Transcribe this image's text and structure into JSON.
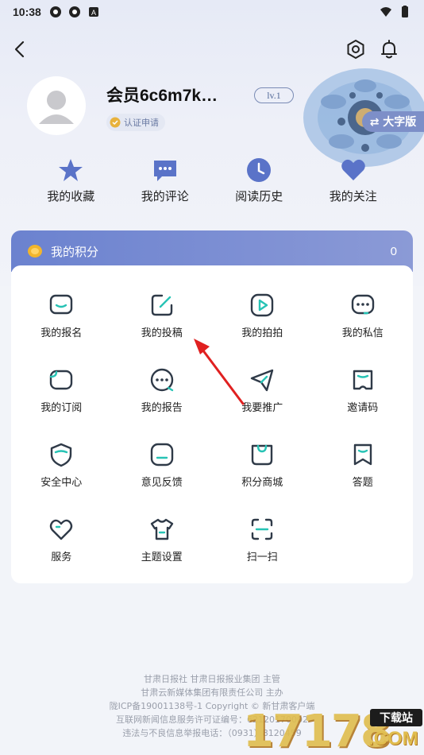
{
  "status_bar": {
    "time": "10:38"
  },
  "profile": {
    "username": "会员6c6m7k…",
    "level": "lv.1",
    "verify_label": "认证申请",
    "font_size_button": "⇄ 大字版"
  },
  "quick_links": [
    {
      "label": "我的收藏",
      "icon": "star-icon"
    },
    {
      "label": "我的评论",
      "icon": "comment-icon"
    },
    {
      "label": "阅读历史",
      "icon": "clock-icon"
    },
    {
      "label": "我的关注",
      "icon": "heart-icon"
    }
  ],
  "points": {
    "label": "我的积分",
    "value": "0"
  },
  "grid": [
    {
      "label": "我的报名",
      "icon": "signup-icon"
    },
    {
      "label": "我的投稿",
      "icon": "edit-icon"
    },
    {
      "label": "我的拍拍",
      "icon": "video-icon"
    },
    {
      "label": "我的私信",
      "icon": "message-icon"
    },
    {
      "label": "我的订阅",
      "icon": "subscribe-icon"
    },
    {
      "label": "我的报告",
      "icon": "report-icon"
    },
    {
      "label": "我要推广",
      "icon": "send-icon"
    },
    {
      "label": "邀请码",
      "icon": "invite-icon"
    },
    {
      "label": "安全中心",
      "icon": "shield-icon"
    },
    {
      "label": "意见反馈",
      "icon": "feedback-icon"
    },
    {
      "label": "积分商城",
      "icon": "shop-icon"
    },
    {
      "label": "答题",
      "icon": "quiz-icon"
    },
    {
      "label": "服务",
      "icon": "service-heart-icon"
    },
    {
      "label": "主题设置",
      "icon": "tshirt-icon"
    },
    {
      "label": "扫一扫",
      "icon": "scan-icon"
    }
  ],
  "footer": {
    "line1": "甘肃日报社  甘肃日报报业集团  主管",
    "line2": "甘肃云新媒体集团有限责任公司  主办",
    "line3": "陇ICP备19001138号-1   Copyright © 新甘肃客户端",
    "line4": "互联网新闻信息服务许可证编号：62120170002",
    "line5": "违法与不良信息举报电话：（0931）8120459"
  },
  "watermark": {
    "digits": "17178",
    "tag": "下载站",
    "suffix": ".COM"
  },
  "colors": {
    "accent": "#6b82cf",
    "icon_teal": "#27c3b5",
    "icon_dark": "#2f3a48"
  }
}
